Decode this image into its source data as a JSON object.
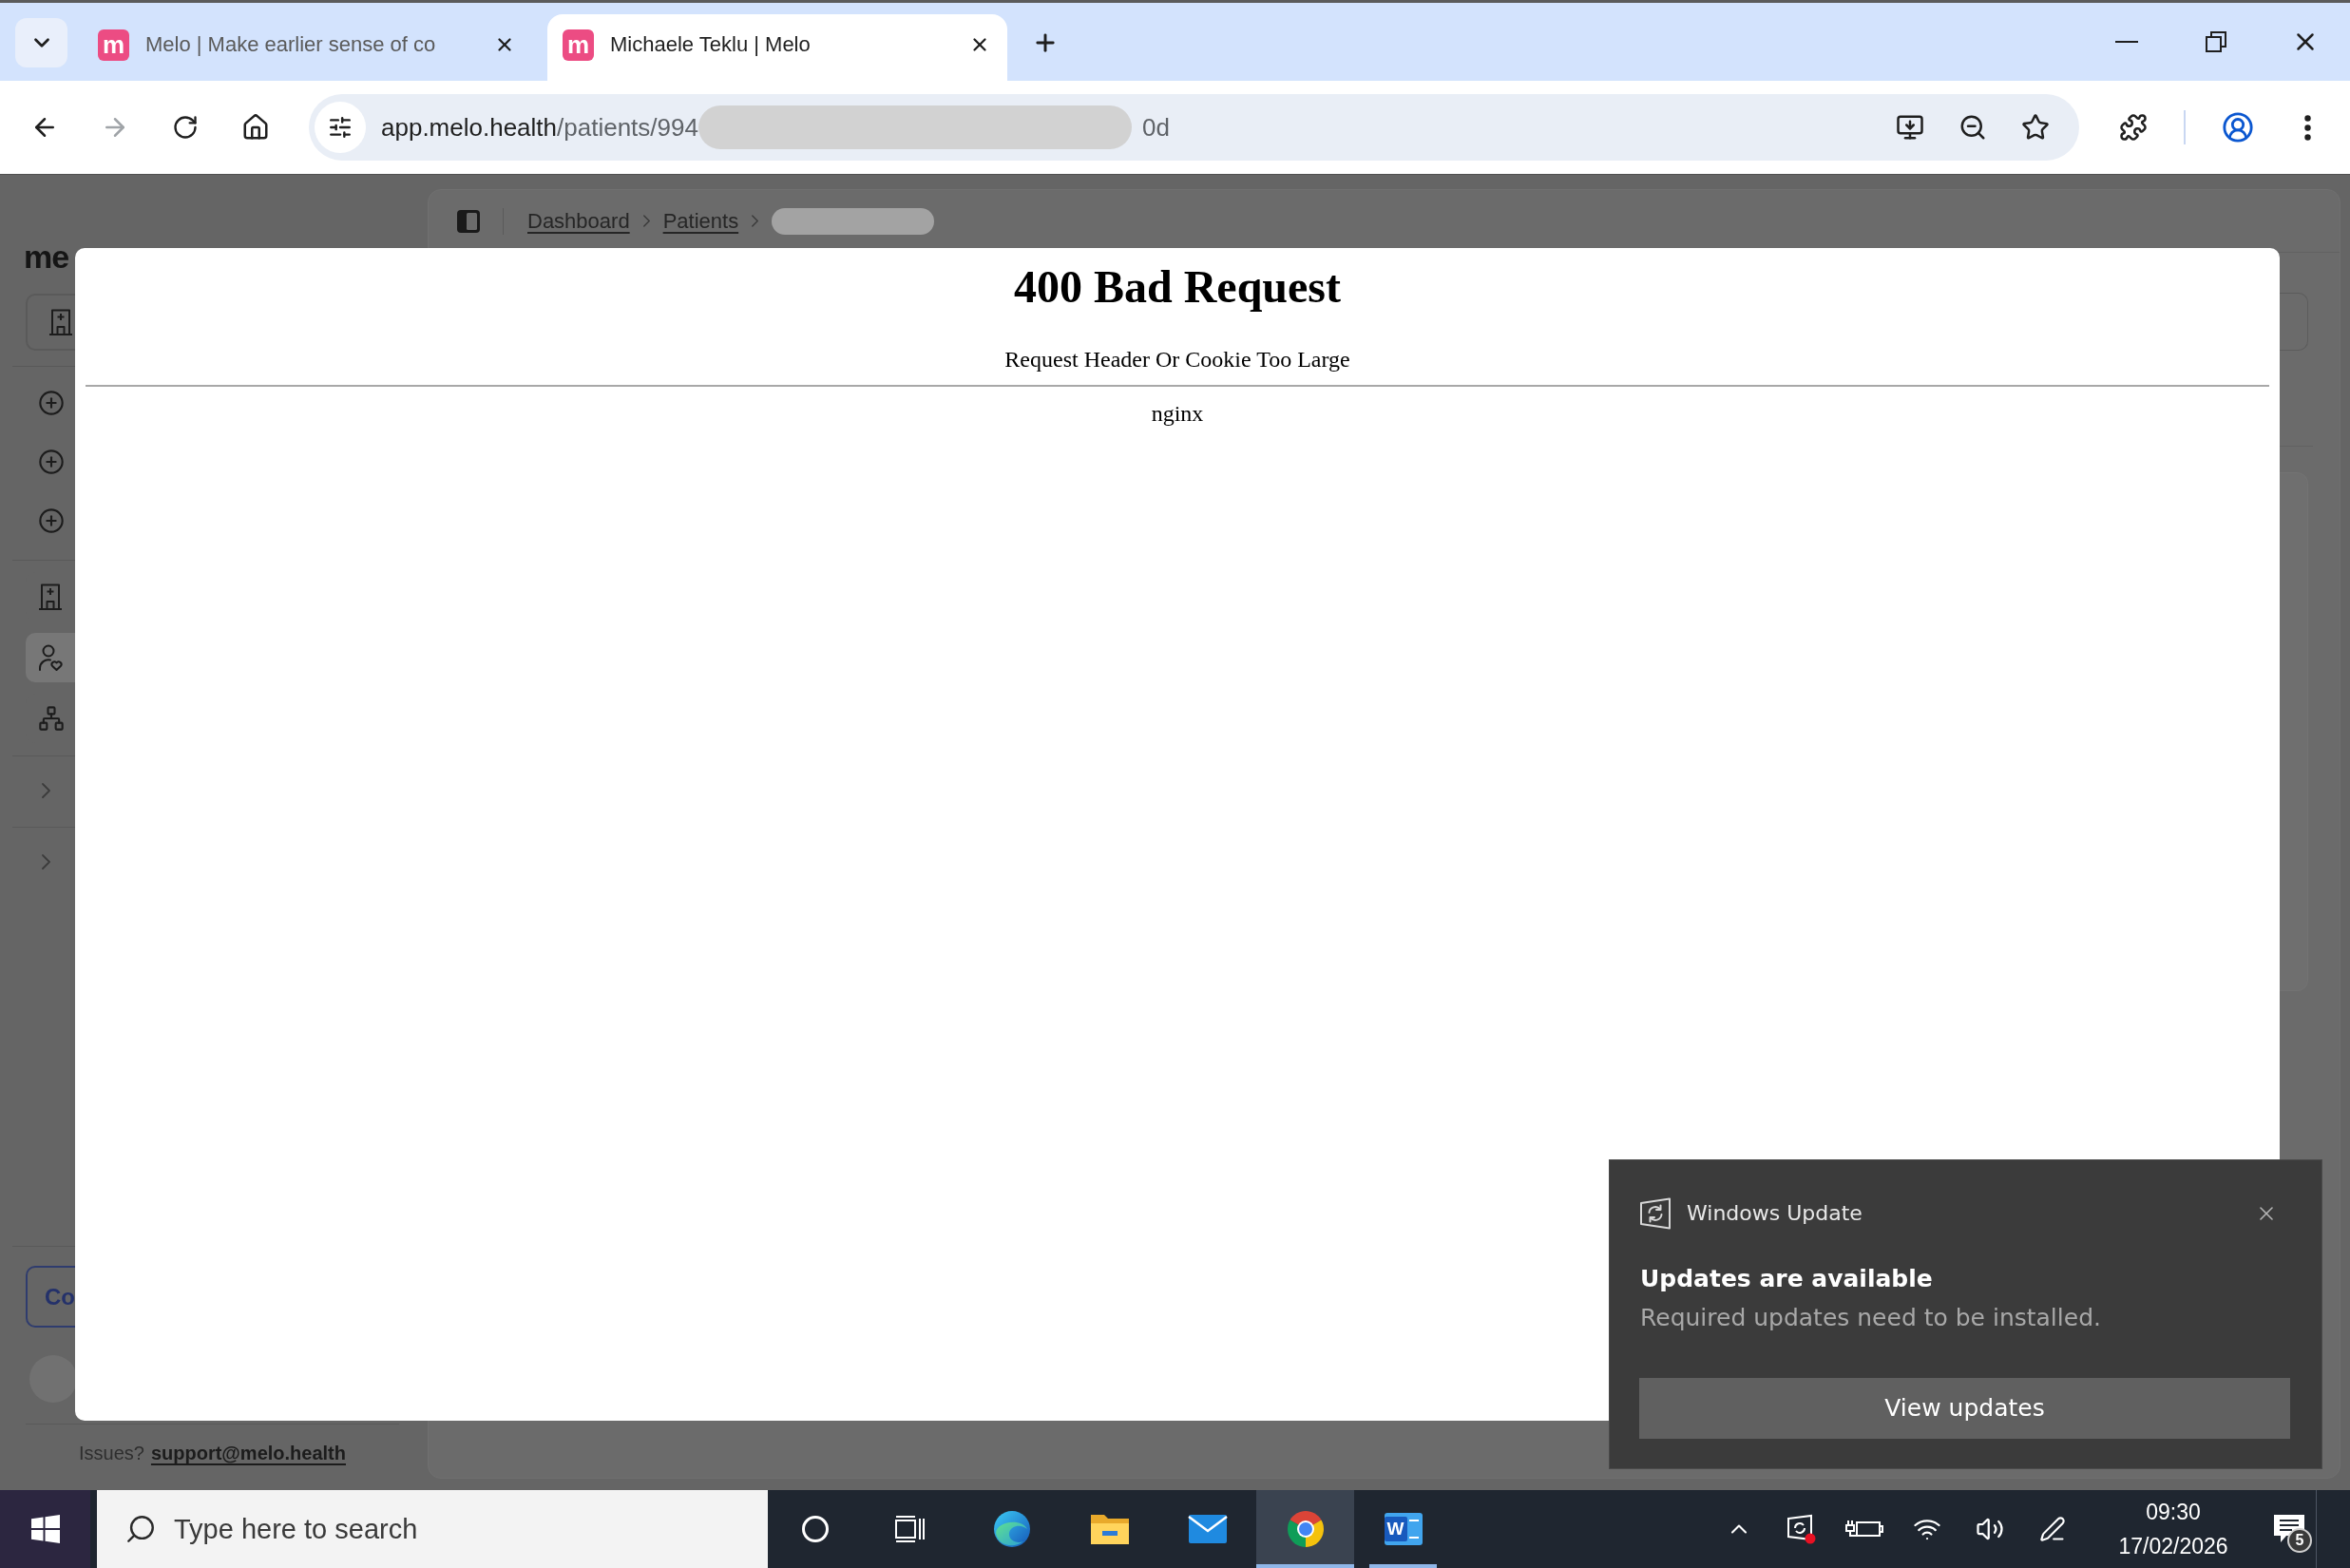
{
  "browser": {
    "tabs": [
      {
        "favicon": "m",
        "title": "Melo | Make earlier sense of co",
        "selected": false
      },
      {
        "favicon": "m",
        "title": "Michaele Teklu | Melo",
        "selected": true
      }
    ],
    "nav_buttons": [
      {
        "kind": "back",
        "disabled": false
      },
      {
        "kind": "forward",
        "disabled": true
      },
      {
        "kind": "reload",
        "disabled": false
      },
      {
        "kind": "home",
        "disabled": false
      }
    ],
    "address_bar": {
      "host": "app.melo.health",
      "path": "/patients/994",
      "redacted": true,
      "tail": "0d"
    }
  },
  "app": {
    "sidebar": {
      "logo": "me",
      "actions": [
        {
          "kind": "add"
        },
        {
          "kind": "add"
        },
        {
          "kind": "add"
        }
      ],
      "nav": [
        {
          "kind": "building",
          "selected": false
        },
        {
          "kind": "patients",
          "selected": true
        },
        {
          "kind": "organisation",
          "selected": false
        }
      ],
      "sections": [
        {
          "expanded": false
        },
        {
          "expanded": false
        }
      ],
      "button": "Co",
      "footer": {
        "text": "Issues?",
        "link": "support@melo.health"
      }
    },
    "breadcrumb": [
      {
        "kind": "link",
        "label": "Dashboard"
      },
      {
        "kind": "link",
        "label": "Patients"
      },
      {
        "kind": "redacted"
      }
    ]
  },
  "error_page": {
    "heading": "400 Bad Request",
    "message": "Request Header Or Cookie Too Large",
    "server": "nginx"
  },
  "notification": {
    "app": "Windows Update",
    "title": "Updates are available",
    "body": "Required updates need to be installed.",
    "button": "View updates"
  },
  "taskbar": {
    "search": {
      "placeholder": "Type here to search"
    },
    "apps": [
      {
        "kind": "edge",
        "running": false,
        "selected": false
      },
      {
        "kind": "explorer",
        "running": false,
        "selected": false
      },
      {
        "kind": "mail",
        "running": false,
        "selected": false
      },
      {
        "kind": "chrome",
        "running": true,
        "selected": true
      },
      {
        "kind": "word",
        "letter": "W",
        "running": true,
        "selected": false
      }
    ],
    "clock": {
      "time": "09:30",
      "date": "17/02/2026"
    },
    "notifications": {
      "count": "5"
    }
  }
}
